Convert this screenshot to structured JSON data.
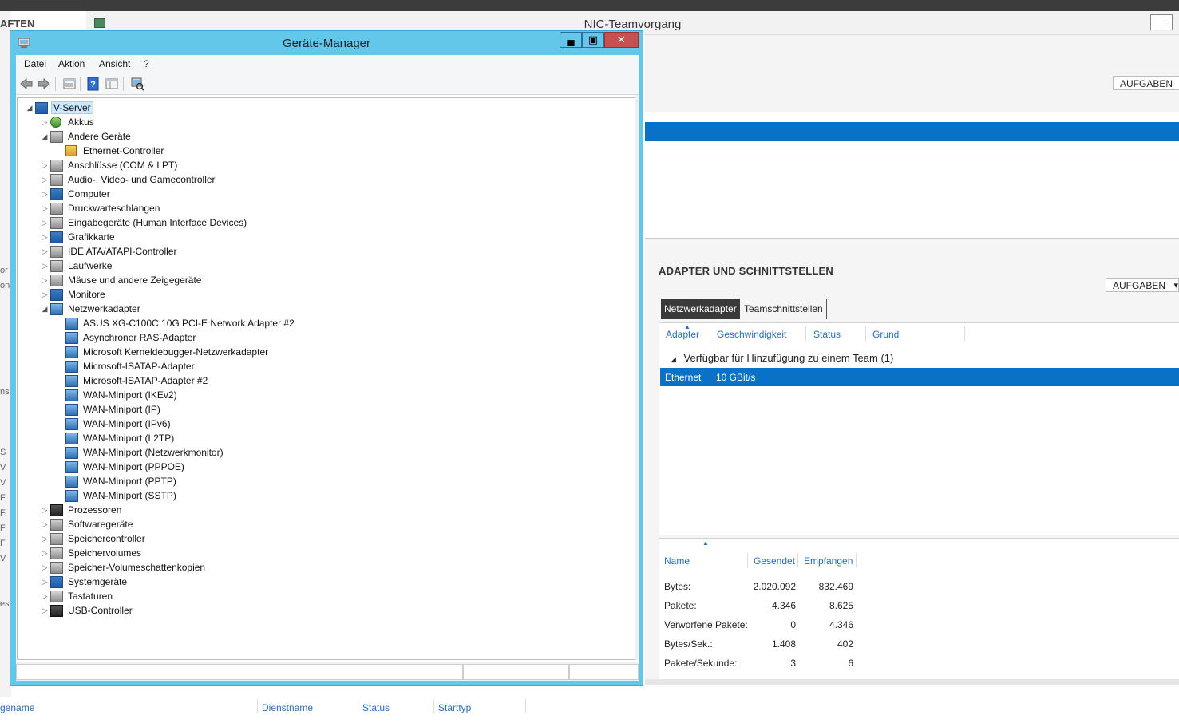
{
  "background": {
    "left_header": "AFTEN",
    "left_fragments": [
      "or",
      "on",
      "",
      "",
      "",
      "",
      "",
      "",
      "nsc",
      "",
      "",
      "",
      "S",
      "V",
      "V",
      "F",
      "F",
      "F",
      "F",
      "V",
      "",
      "",
      "es"
    ],
    "bottom_columns": [
      "gename",
      "Dienstname",
      "Status",
      "Starttyp"
    ]
  },
  "nic_window": {
    "title": "NIC-Teamvorgang",
    "minimize_glyph": "—",
    "aufgaben_top": "AUFGABEN",
    "section_heading": "ADAPTER UND SCHNITTSTELLEN",
    "aufgaben_section": "AUFGABEN",
    "aufgaben_arrow": "▾",
    "tabs": {
      "active": "Netzwerkadapter",
      "inactive": "Teamschnittstellen"
    },
    "columns": [
      "Adapter",
      "Geschwindigkeit",
      "Status",
      "Grund"
    ],
    "group_arrow": "◢",
    "group_label": "Verfügbar für Hinzufügung zu einem Team (1)",
    "selected_row": {
      "name": "Ethernet",
      "speed": "10 GBit/s"
    },
    "stats_columns": [
      "Name",
      "Gesendet",
      "Empfangen"
    ],
    "stats": [
      {
        "label": "Bytes:",
        "sent": "2.020.092",
        "received": "832.469"
      },
      {
        "label": "Pakete:",
        "sent": "4.346",
        "received": "8.625"
      },
      {
        "label": "Verworfene Pakete:",
        "sent": "0",
        "received": "4.346"
      },
      {
        "label": "Bytes/Sek.:",
        "sent": "1.408",
        "received": "402"
      },
      {
        "label": "Pakete/Sekunde:",
        "sent": "3",
        "received": "6"
      }
    ]
  },
  "device_manager": {
    "title": "Geräte-Manager",
    "controls": {
      "minimize": "▄",
      "maximize": "▣",
      "close": "✕"
    },
    "menu": [
      "Datei",
      "Aktion",
      "Ansicht",
      "?"
    ],
    "toolbar_icons": [
      "back-arrow-icon",
      "forward-arrow-icon",
      "properties-list-icon",
      "help-icon",
      "details-view-icon",
      "scan-hardware-icon"
    ],
    "tree": [
      {
        "label": "V-Server",
        "level": 0,
        "expander": "◢",
        "icon": "computer-icon",
        "root": true
      },
      {
        "label": "Akkus",
        "level": 1,
        "expander": "▷",
        "icon": "battery-icon"
      },
      {
        "label": "Andere Geräte",
        "level": 1,
        "expander": "◢",
        "icon": "unknown-device-icon"
      },
      {
        "label": "Ethernet-Controller",
        "level": 2,
        "expander": "",
        "icon": "warning-device-icon"
      },
      {
        "label": "Anschlüsse (COM & LPT)",
        "level": 1,
        "expander": "▷",
        "icon": "port-icon"
      },
      {
        "label": "Audio-, Video- und Gamecontroller",
        "level": 1,
        "expander": "▷",
        "icon": "speaker-icon"
      },
      {
        "label": "Computer",
        "level": 1,
        "expander": "▷",
        "icon": "computer-icon"
      },
      {
        "label": "Druckwarteschlangen",
        "level": 1,
        "expander": "▷",
        "icon": "printer-icon"
      },
      {
        "label": "Eingabegeräte (Human Interface Devices)",
        "level": 1,
        "expander": "▷",
        "icon": "hid-icon"
      },
      {
        "label": "Grafikkarte",
        "level": 1,
        "expander": "▷",
        "icon": "display-adapter-icon"
      },
      {
        "label": "IDE ATA/ATAPI-Controller",
        "level": 1,
        "expander": "▷",
        "icon": "ide-controller-icon"
      },
      {
        "label": "Laufwerke",
        "level": 1,
        "expander": "▷",
        "icon": "disk-drive-icon"
      },
      {
        "label": "Mäuse und andere Zeigegeräte",
        "level": 1,
        "expander": "▷",
        "icon": "mouse-icon"
      },
      {
        "label": "Monitore",
        "level": 1,
        "expander": "▷",
        "icon": "monitor-icon"
      },
      {
        "label": "Netzwerkadapter",
        "level": 1,
        "expander": "◢",
        "icon": "network-adapter-icon"
      },
      {
        "label": "ASUS XG-C100C 10G PCI-E Network Adapter #2",
        "level": 2,
        "expander": "",
        "icon": "network-adapter-icon"
      },
      {
        "label": "Asynchroner RAS-Adapter",
        "level": 2,
        "expander": "",
        "icon": "network-adapter-icon"
      },
      {
        "label": "Microsoft Kerneldebugger-Netzwerkadapter",
        "level": 2,
        "expander": "",
        "icon": "network-adapter-icon"
      },
      {
        "label": "Microsoft-ISATAP-Adapter",
        "level": 2,
        "expander": "",
        "icon": "network-adapter-icon"
      },
      {
        "label": "Microsoft-ISATAP-Adapter #2",
        "level": 2,
        "expander": "",
        "icon": "network-adapter-icon"
      },
      {
        "label": "WAN-Miniport (IKEv2)",
        "level": 2,
        "expander": "",
        "icon": "network-adapter-icon"
      },
      {
        "label": "WAN-Miniport (IP)",
        "level": 2,
        "expander": "",
        "icon": "network-adapter-icon"
      },
      {
        "label": "WAN-Miniport (IPv6)",
        "level": 2,
        "expander": "",
        "icon": "network-adapter-icon"
      },
      {
        "label": "WAN-Miniport (L2TP)",
        "level": 2,
        "expander": "",
        "icon": "network-adapter-icon"
      },
      {
        "label": "WAN-Miniport (Netzwerkmonitor)",
        "level": 2,
        "expander": "",
        "icon": "network-adapter-icon"
      },
      {
        "label": "WAN-Miniport (PPPOE)",
        "level": 2,
        "expander": "",
        "icon": "network-adapter-icon"
      },
      {
        "label": "WAN-Miniport (PPTP)",
        "level": 2,
        "expander": "",
        "icon": "network-adapter-icon"
      },
      {
        "label": "WAN-Miniport (SSTP)",
        "level": 2,
        "expander": "",
        "icon": "network-adapter-icon"
      },
      {
        "label": "Prozessoren",
        "level": 1,
        "expander": "▷",
        "icon": "processor-icon"
      },
      {
        "label": "Softwaregeräte",
        "level": 1,
        "expander": "▷",
        "icon": "software-device-icon"
      },
      {
        "label": "Speichercontroller",
        "level": 1,
        "expander": "▷",
        "icon": "storage-controller-icon"
      },
      {
        "label": "Speichervolumes",
        "level": 1,
        "expander": "▷",
        "icon": "storage-volume-icon"
      },
      {
        "label": "Speicher-Volumeschattenkopien",
        "level": 1,
        "expander": "▷",
        "icon": "shadow-copy-icon"
      },
      {
        "label": "Systemgeräte",
        "level": 1,
        "expander": "▷",
        "icon": "system-device-icon"
      },
      {
        "label": "Tastaturen",
        "level": 1,
        "expander": "▷",
        "icon": "keyboard-icon"
      },
      {
        "label": "USB-Controller",
        "level": 1,
        "expander": "▷",
        "icon": "usb-icon"
      }
    ]
  }
}
